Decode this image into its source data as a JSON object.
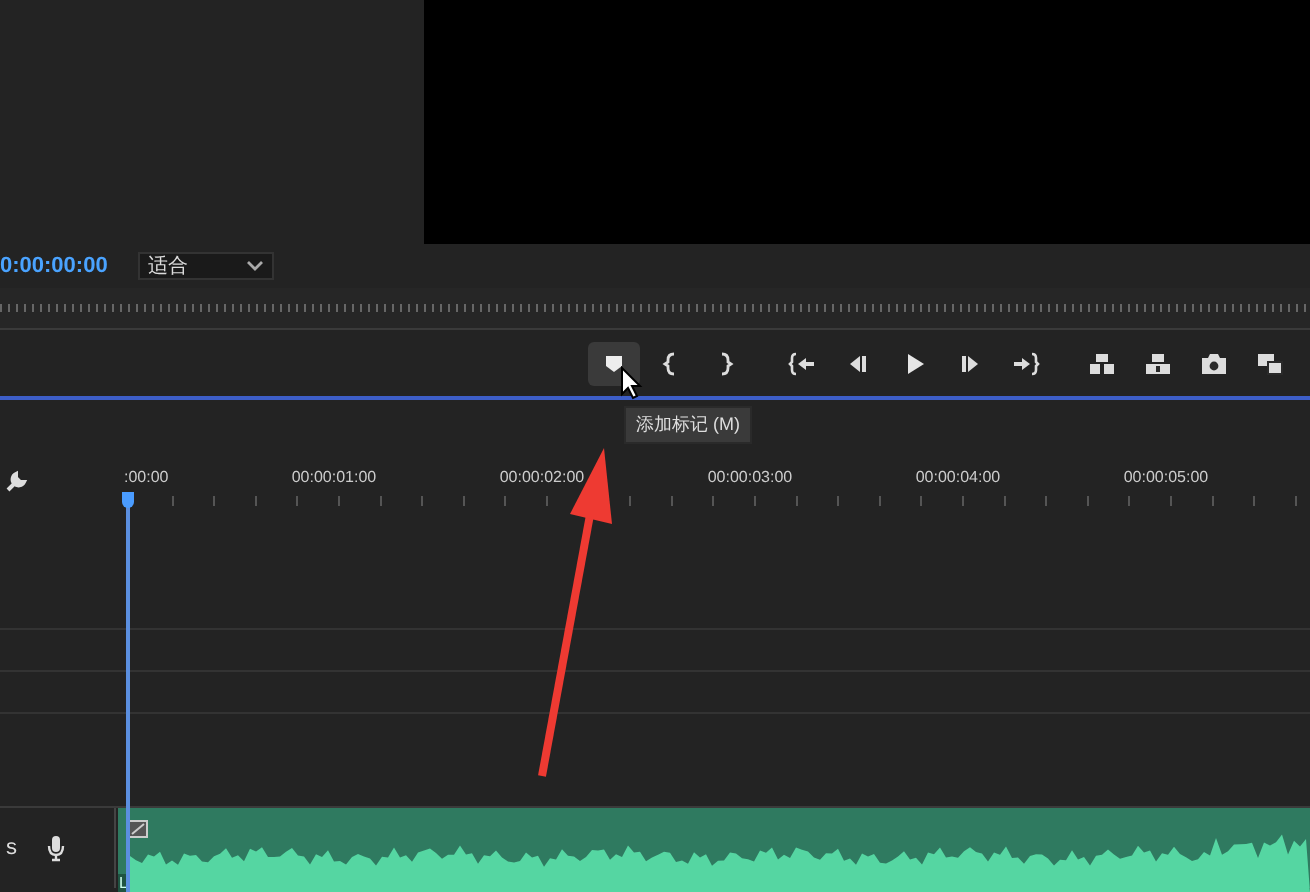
{
  "monitor": {
    "timecode": "0:00:00:00",
    "zoom_dropdown": {
      "value": "适合"
    }
  },
  "transport_buttons": [
    {
      "kind": "marker",
      "hovered": true
    },
    {
      "kind": "mark-in",
      "hovered": false
    },
    {
      "kind": "mark-out",
      "hovered": false
    },
    {
      "kind": "go-to-in",
      "hovered": false
    },
    {
      "kind": "step-back",
      "hovered": false
    },
    {
      "kind": "play",
      "hovered": false
    },
    {
      "kind": "step-forward",
      "hovered": false
    },
    {
      "kind": "go-to-out",
      "hovered": false
    },
    {
      "kind": "insert",
      "hovered": false
    },
    {
      "kind": "overwrite",
      "hovered": false
    },
    {
      "kind": "export-frame",
      "hovered": false
    },
    {
      "kind": "compare",
      "hovered": false
    }
  ],
  "tooltip": "添加标记 (M)",
  "timeline": {
    "ruler_labels": [
      ":00:00",
      "00:00:01:00",
      "00:00:02:00",
      "00:00:03:00",
      "00:00:04:00",
      "00:00:05:00"
    ],
    "tracks": [
      {
        "kind": "video"
      },
      {
        "kind": "video"
      },
      {
        "kind": "video"
      },
      {
        "kind": "audio",
        "label": "s",
        "channel": "L"
      }
    ]
  }
}
